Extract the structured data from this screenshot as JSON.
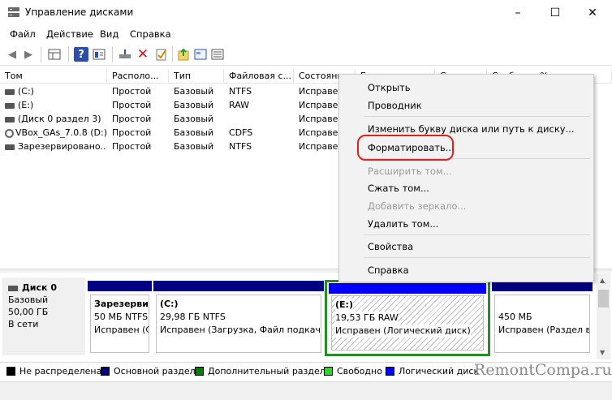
{
  "window": {
    "title": "Управление дисками",
    "controls": [
      "–",
      "☐",
      "✕"
    ]
  },
  "menu": [
    "Файл",
    "Действие",
    "Вид",
    "Справка"
  ],
  "toolbar_icons": [
    "back-icon",
    "forward-icon",
    "grid-icon",
    "help-icon",
    "properties-icon",
    "connect-icon",
    "delete-icon",
    "check-icon",
    "refresh-icon",
    "console-icon"
  ],
  "table": {
    "columns": [
      "Том",
      "Располо...",
      "Тип",
      "Файловая с...",
      "Состояние",
      "Е...",
      "Св...",
      "Свободно %"
    ],
    "rows": [
      {
        "name": "(C:)",
        "layout": "Простой",
        "type": "Базовый",
        "fs": "NTFS",
        "status": "Исправен"
      },
      {
        "name": "(E:)",
        "layout": "Простой",
        "type": "Базовый",
        "fs": "RAW",
        "status": "Исправен"
      },
      {
        "name": "(Диск 0 раздел 3)",
        "layout": "Простой",
        "type": "Базовый",
        "fs": "",
        "status": "Исправен"
      },
      {
        "name": "VBox_GAs_7.0.8 (D:)",
        "layout": "Простой",
        "type": "Базовый",
        "fs": "CDFS",
        "status": "Исправен"
      },
      {
        "name": "Зарезервировано...",
        "layout": "Простой",
        "type": "Базовый",
        "fs": "NTFS",
        "status": "Исправен"
      }
    ]
  },
  "disk": {
    "name": "Диск 0",
    "type": "Базовый",
    "size": "50,00 ГБ",
    "status": "В сети",
    "partitions": [
      {
        "title": "Зарезервир",
        "size": "50 МБ NTFS",
        "status": "Исправен (С"
      },
      {
        "title": "(C:)",
        "size": "29,98 ГБ NTFS",
        "status": "Исправен (Загрузка, Файл подкачки"
      },
      {
        "title": "(E:)",
        "size": "19,53 ГБ RAW",
        "status": "Исправен (Логический диск)"
      },
      {
        "title": "",
        "size": "450 МБ",
        "status": "Исправен (Раздел во"
      }
    ]
  },
  "legend": [
    {
      "label": "Не распределена",
      "color": "#000000"
    },
    {
      "label": "Основной раздел",
      "color": "#000080"
    },
    {
      "label": "Дополнительный раздел",
      "color": "#008000"
    },
    {
      "label": "Свободно",
      "color": "#33cc33"
    },
    {
      "label": "Логический диск",
      "color": "#0000ff"
    }
  ],
  "context_menu": {
    "items": [
      {
        "label": "Открыть",
        "enabled": true
      },
      {
        "label": "Проводник",
        "enabled": true
      },
      {
        "label": "Изменить букву диска или путь к диску...",
        "enabled": true
      },
      {
        "label": "Форматировать...",
        "enabled": true,
        "highlighted": true
      },
      {
        "label": "Расширить том...",
        "enabled": false
      },
      {
        "label": "Сжать том...",
        "enabled": true
      },
      {
        "label": "Добавить зеркало...",
        "enabled": false
      },
      {
        "label": "Удалить том...",
        "enabled": true
      },
      {
        "label": "Свойства",
        "enabled": true
      },
      {
        "label": "Справка",
        "enabled": true
      }
    ]
  },
  "watermark": "RemontCompa.ru",
  "colors": {
    "primary_partition": "#000080",
    "logical_disk": "#0000ff",
    "extended_partition": "#008000",
    "highlight_ring": "#e3211a"
  }
}
